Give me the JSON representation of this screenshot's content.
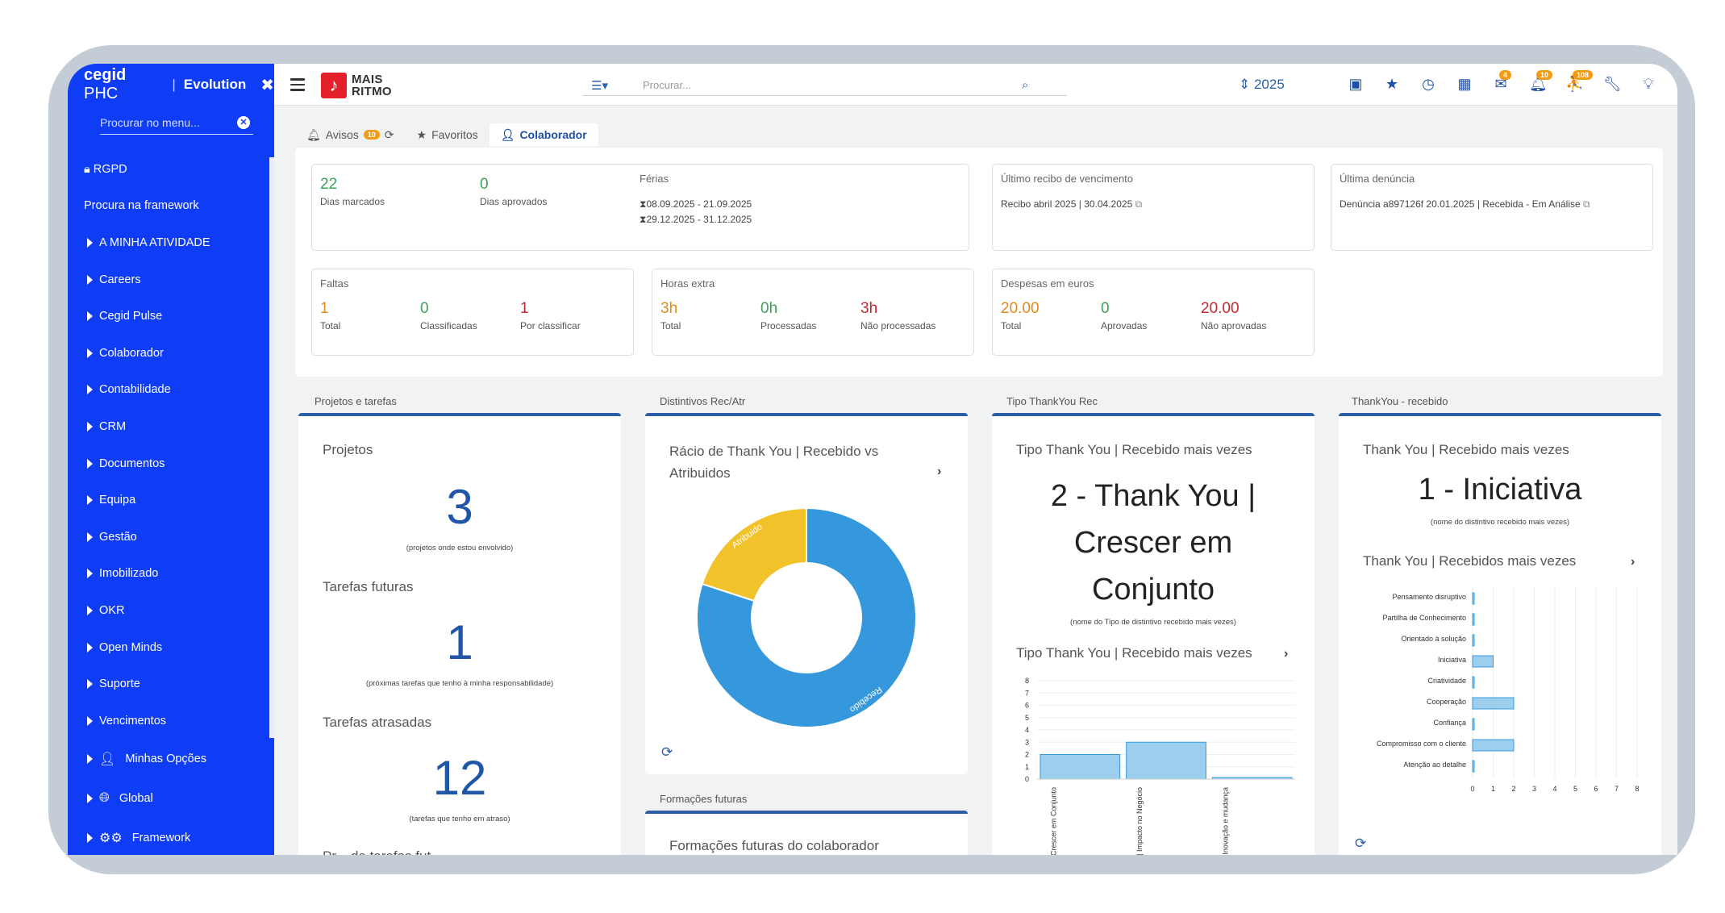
{
  "sidebar": {
    "logo_cegid": "cegid",
    "logo_phc": "PHC",
    "evolution": "Evolution",
    "search_placeholder": "Procurar no menu...",
    "items": [
      {
        "label": "RGPD",
        "icon": "lock-icon"
      },
      {
        "label": "Procura na framework"
      },
      {
        "label": "A MINHA ATIVIDADE"
      },
      {
        "label": "Careers"
      },
      {
        "label": "Cegid Pulse"
      },
      {
        "label": "Colaborador"
      },
      {
        "label": "Contabilidade"
      },
      {
        "label": "CRM"
      },
      {
        "label": "Documentos"
      },
      {
        "label": "Equipa"
      },
      {
        "label": "Gestão"
      },
      {
        "label": "Imobilizado"
      },
      {
        "label": "OKR"
      },
      {
        "label": "Open Minds"
      },
      {
        "label": "Suporte"
      },
      {
        "label": "Vencimentos"
      },
      {
        "label": "Minhas Opções",
        "icon": "user-icon"
      },
      {
        "label": "Global",
        "icon": "globe-icon"
      },
      {
        "label": "Framework",
        "icon": "cogs-icon"
      }
    ]
  },
  "topbar": {
    "brand_line1": "MAIS",
    "brand_line2": "RITMO",
    "search_placeholder": "Procurar...",
    "year": "2025",
    "badges": {
      "mail": "4",
      "bell": "10",
      "user": "108"
    }
  },
  "tabs": [
    {
      "label": "Avisos",
      "badge": "10"
    },
    {
      "label": "Favoritos"
    },
    {
      "label": "Colaborador"
    }
  ],
  "summary": {
    "dias_marcados": {
      "value": "22",
      "label": "Dias marcados"
    },
    "dias_aprovados": {
      "value": "0",
      "label": "Dias aprovados"
    },
    "ferias": {
      "title": "Férias",
      "periods": [
        "08.09.2025 - 21.09.2025",
        "29.12.2025 - 31.12.2025"
      ]
    },
    "recibo": {
      "title": "Último recibo de vencimento",
      "text": "Recibo abril 2025 | 30.04.2025"
    },
    "denuncia": {
      "title": "Última denúncia",
      "text": "Denúncia a897126f 20.01.2025 | Recebida - Em Análise"
    },
    "faltas": {
      "title": "Faltas",
      "total": "1",
      "total_label": "Total",
      "classificadas": "0",
      "classificadas_label": "Classificadas",
      "por_classificar": "1",
      "por_classificar_label": "Por classificar"
    },
    "horas": {
      "title": "Horas extra",
      "total": "3h",
      "total_label": "Total",
      "processadas": "0h",
      "processadas_label": "Processadas",
      "nao": "3h",
      "nao_label": "Não processadas"
    },
    "despesas": {
      "title": "Despesas em euros",
      "total": "20.00",
      "total_label": "Total",
      "aprovadas": "0",
      "aprovadas_label": "Aprovadas",
      "nao": "20.00",
      "nao_label": "Não aprovadas"
    }
  },
  "widgets": {
    "projetos": {
      "section": "Projetos e tarefas",
      "projetos_title": "Projetos",
      "projetos_value": "3",
      "projetos_cap": "(projetos onde estou envolvido)",
      "futuras_title": "Tarefas futuras",
      "futuras_value": "1",
      "futuras_cap": "(próximas tarefas que tenho à minha responsabilidade)",
      "atrasadas_title": "Tarefas atrasadas",
      "atrasadas_value": "12",
      "atrasadas_cap": "(tarefas que tenho em atraso)",
      "cut_title": "Pr... de tarefas fut..."
    },
    "distintivos": {
      "section": "Distintivos Rec/Atr",
      "title": "Rácio de Thank You | Recebido vs Atribuidos",
      "formacoes_section": "Formações futuras",
      "formacoes_title": "Formações futuras do colaborador"
    },
    "tipo": {
      "section": "Tipo ThankYou Rec",
      "title": "Tipo Thank You | Recebido mais vezes",
      "value": "2 - Thank You | Crescer em Conjunto",
      "cap": "(nome do Tipo de distintivo recebido mais vezes)",
      "chart_title": "Tipo Thank You | Recebido mais vezes"
    },
    "thankyou": {
      "section": "ThankYou - recebido",
      "title": "Thank You | Recebido mais vezes",
      "value": "1 - Iniciativa",
      "cap": "(nome do distintivo recebido mais vezes)",
      "chart_title": "Thank You | Recebidos mais vezes"
    }
  },
  "chart_data": [
    {
      "type": "pie",
      "categories": [
        "Recebido",
        "Atribuido"
      ],
      "values": [
        80,
        20
      ],
      "colors": [
        "#3598dc",
        "#f2c22a"
      ]
    },
    {
      "type": "bar",
      "categories": [
        "Thank You | Crescer em Conjunto",
        "Thank You | Impacto no Negócio",
        "Thank You | Inovação e mudança"
      ],
      "values": [
        2,
        3,
        0
      ],
      "ylim": [
        0,
        8
      ],
      "yticks": [
        "0",
        "1",
        "2",
        "3",
        "4",
        "5",
        "6",
        "7",
        "8"
      ],
      "grid": true
    },
    {
      "type": "bar",
      "orientation": "horizontal",
      "categories": [
        "Pensamento disruptivo",
        "Partilha de Conhecimento",
        "Orientado à solução",
        "Iniciativa",
        "Criatividade",
        "Cooperação",
        "Confiança",
        "Compromisso com o cliente",
        "Atenção ao detalhe"
      ],
      "values": [
        0,
        0,
        0,
        1,
        0,
        2,
        0,
        2,
        0
      ],
      "xlim": [
        0,
        8
      ],
      "xticks": [
        "0",
        "1",
        "2",
        "3",
        "4",
        "5",
        "6",
        "7",
        "8"
      ],
      "grid": true
    }
  ]
}
